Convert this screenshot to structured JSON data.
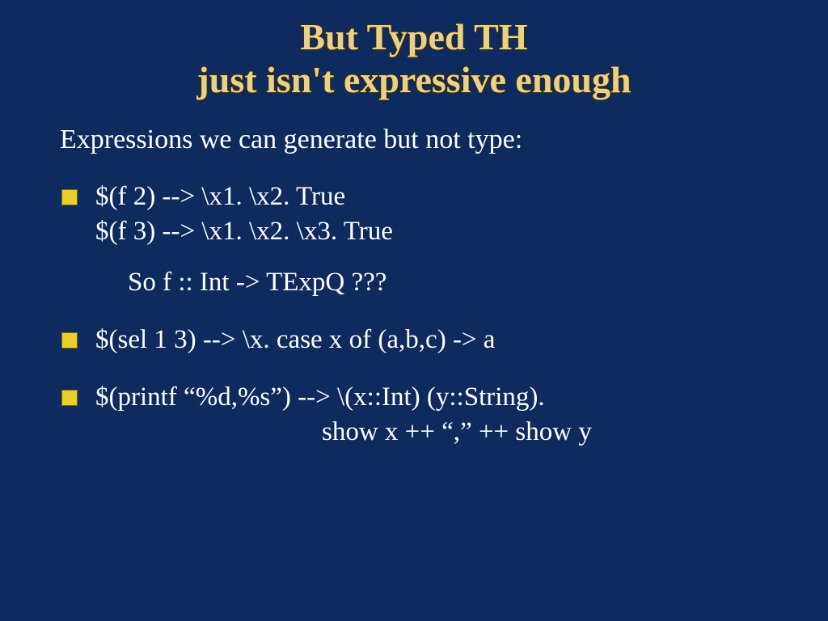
{
  "title_line1": "But Typed TH",
  "title_line2": "just isn't expressive enough",
  "subtitle": "Expressions we can generate but not type:",
  "bullets": [
    {
      "line1": "$(f 2)  -->  \\x1. \\x2. True",
      "line2": "$(f 3)  -->  \\x1. \\x2. \\x3. True",
      "indent": "So f :: Int -> TExpQ ???"
    },
    {
      "line1": "$(sel 1 3)  -->  \\x. case x of (a,b,c) -> a"
    },
    {
      "line1": "$(printf “%d,%s”)  -->  \\(x::Int) (y::String).",
      "right": "show x ++ “,” ++ show y"
    }
  ]
}
